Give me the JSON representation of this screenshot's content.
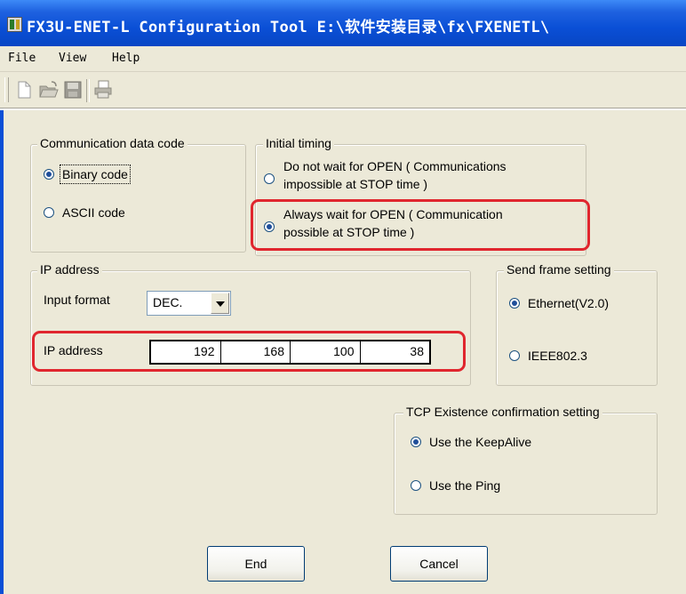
{
  "window": {
    "title": "FX3U-ENET-L Configuration Tool E:\\软件安装目录\\fx\\FXENETL\\"
  },
  "menu": {
    "file": "File",
    "view": "View",
    "help": "Help"
  },
  "toolbar": {
    "icons": [
      "new-file-icon",
      "open-folder-icon",
      "save-disk-icon",
      "print-icon"
    ]
  },
  "comm_data_code": {
    "legend": "Communication data code",
    "binary_label": "Binary code",
    "ascii_label": "ASCII code",
    "selected": "binary"
  },
  "initial_timing": {
    "legend": "Initial timing",
    "opt1_line1": "Do not wait for OPEN ( Communications",
    "opt1_line2": "impossible at STOP time )",
    "opt2_line1": "Always wait for OPEN ( Communication",
    "opt2_line2": "possible at STOP time )",
    "selected": "always_wait"
  },
  "ip": {
    "legend": "IP address",
    "input_format_label": "Input format",
    "input_format_value": "DEC.",
    "ip_label": "IP address",
    "octets": [
      "192",
      "168",
      "100",
      "38"
    ]
  },
  "send_frame": {
    "legend": "Send frame setting",
    "ethernet_label": "Ethernet(V2.0)",
    "ieee_label": "IEEE802.3",
    "selected": "ethernet"
  },
  "tcp": {
    "legend": "TCP Existence confirmation setting",
    "keepalive_label": "Use the KeepAlive",
    "ping_label": "Use the Ping",
    "selected": "keepalive"
  },
  "buttons": {
    "end": "End",
    "cancel": "Cancel"
  },
  "colors": {
    "title_bar": "#0a4fd6",
    "dialog_bg": "#ece9d8",
    "highlight": "#e0262e"
  }
}
